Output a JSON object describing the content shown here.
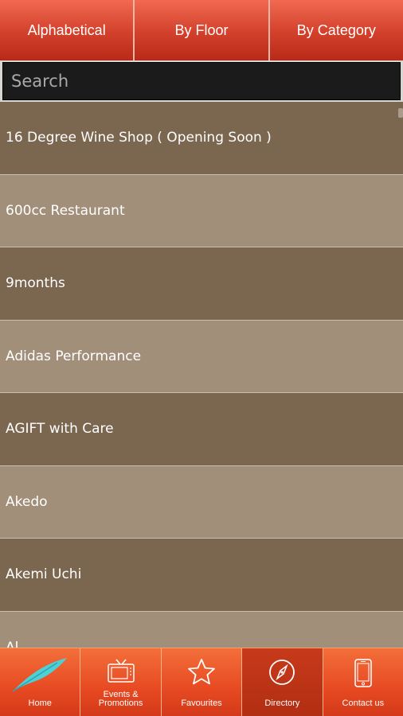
{
  "tabs": [
    {
      "label": "Alphabetical"
    },
    {
      "label": "By Floor"
    },
    {
      "label": "By Category"
    }
  ],
  "search": {
    "placeholder": "Search",
    "value": ""
  },
  "stores": [
    {
      "name": "16 Degree Wine Shop ( Opening Soon )"
    },
    {
      "name": "600cc Restaurant"
    },
    {
      "name": "9months"
    },
    {
      "name": "Adidas Performance"
    },
    {
      "name": "AGIFT with Care"
    },
    {
      "name": "Akedo"
    },
    {
      "name": "Akemi Uchi"
    },
    {
      "name": "Al..."
    }
  ],
  "bottom_nav": [
    {
      "label": "Home",
      "icon": "feather-icon"
    },
    {
      "label": "Events & Promotions",
      "icon": "tv-icon"
    },
    {
      "label": "Favourites",
      "icon": "star-icon"
    },
    {
      "label": "Directory",
      "icon": "compass-icon",
      "active": true
    },
    {
      "label": "Contact us",
      "icon": "phone-icon"
    }
  ],
  "colors": {
    "tab_red": "#d2402b",
    "row_dark": "#7b6650",
    "row_light": "#a28f7a",
    "nav_orange": "#e74a22",
    "nav_active": "#b22e12",
    "feather_teal": "#4fd0d6"
  }
}
